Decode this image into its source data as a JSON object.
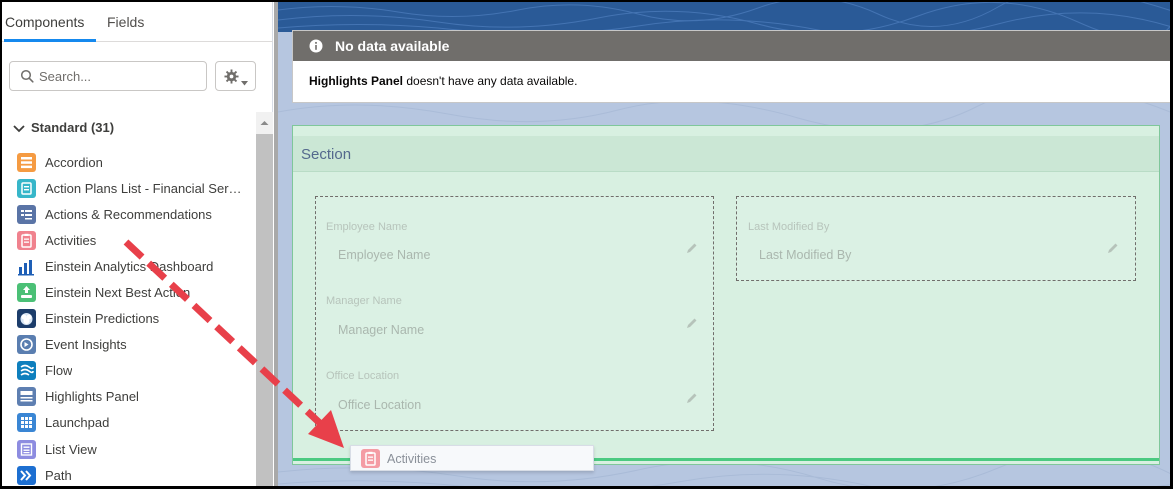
{
  "tabs": {
    "components": "Components",
    "fields": "Fields"
  },
  "search": {
    "placeholder": "Search..."
  },
  "standard": {
    "heading": "Standard (31)"
  },
  "components": [
    {
      "label": "Accordion",
      "icon": "accordion-icon",
      "color": "#f59b42"
    },
    {
      "label": "Action Plans List - Financial Services Cloud",
      "icon": "action-plans-icon",
      "color": "#37b6c9"
    },
    {
      "label": "Actions & Recommendations",
      "icon": "actions-recommendations-icon",
      "color": "#5a74a6"
    },
    {
      "label": "Activities",
      "icon": "activities-icon",
      "color": "#f0828e"
    },
    {
      "label": "Einstein Analytics Dashboard",
      "icon": "analytics-dashboard-icon",
      "color": "#1e5fb6"
    },
    {
      "label": "Einstein Next Best Action",
      "icon": "next-best-action-icon",
      "color": "#4bc076"
    },
    {
      "label": "Einstein Predictions",
      "icon": "einstein-predictions-icon",
      "color": "#1c3d6b"
    },
    {
      "label": "Event Insights",
      "icon": "event-insights-icon",
      "color": "#5a7eb0"
    },
    {
      "label": "Flow",
      "icon": "flow-icon",
      "color": "#0e7fbd"
    },
    {
      "label": "Highlights Panel",
      "icon": "highlights-panel-icon",
      "color": "#5e7fb1"
    },
    {
      "label": "Launchpad",
      "icon": "launchpad-icon",
      "color": "#3a86d4"
    },
    {
      "label": "List View",
      "icon": "list-view-icon",
      "color": "#8d8ce0"
    },
    {
      "label": "Path",
      "icon": "path-icon",
      "color": "#1d6fd1"
    }
  ],
  "highlights": {
    "title": "No data available",
    "msg_bold": "Highlights Panel",
    "msg_rest": " doesn't have any data available."
  },
  "section": {
    "title": "Section",
    "fields_left": [
      {
        "label": "Employee Name",
        "value": "Employee Name"
      },
      {
        "label": "Manager Name",
        "value": "Manager Name"
      },
      {
        "label": "Office Location",
        "value": "Office Location"
      }
    ],
    "fields_right": [
      {
        "label": "Last Modified By",
        "value": "Last Modified By"
      }
    ]
  },
  "drag": {
    "label": "Activities"
  },
  "colors": {
    "accent": "#1589ee",
    "arrow": "#e8404a",
    "section_green": "#d8f0e1"
  }
}
